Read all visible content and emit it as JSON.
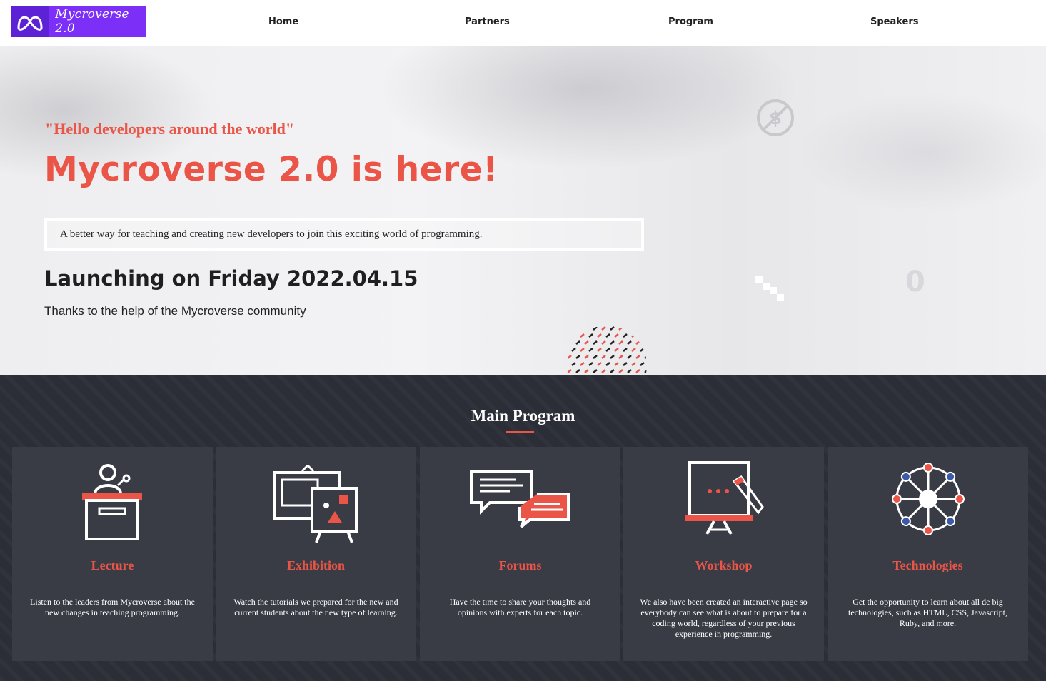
{
  "nav": {
    "logo_text": "Mycroverse 2.0",
    "links": [
      "Home",
      "Partners",
      "Program",
      "Speakers"
    ]
  },
  "hero": {
    "quote": "\"Hello developers around the world\"",
    "title": "Mycroverse 2.0 is here!",
    "description": "A better way for teaching and creating new developers to join this exciting world of programming.",
    "launch": "Launching on Friday 2022.04.15",
    "thanks": "Thanks to the help of the Mycroverse community",
    "deco_text": "0"
  },
  "program": {
    "title": "Main Program",
    "cards": [
      {
        "title": "Lecture",
        "desc": "Listen to the leaders from Mycroverse about the new changes in teaching programming.",
        "icon": "lecture-podium-icon"
      },
      {
        "title": "Exhibition",
        "desc": "Watch the tutorials we prepared for the new and current students about the new type of learning.",
        "icon": "exhibition-easel-icon"
      },
      {
        "title": "Forums",
        "desc": "Have the time to share your thoughts and opinions with experts for each topic.",
        "icon": "forum-chat-icon"
      },
      {
        "title": "Workshop",
        "desc": "We also have been created an interactive page so everybody can see what is about to prepare for a coding world, regardless of your previous experience in programming.",
        "icon": "workshop-board-icon"
      },
      {
        "title": "Technologies",
        "desc": "Get the opportunity to learn about all de big technologies, such as HTML, CSS, Javascript, Ruby, and more.",
        "icon": "technologies-network-icon"
      }
    ]
  },
  "colors": {
    "accent": "#ea5547",
    "brand": "#7b2ff7",
    "dark_bg": "#2c2e37",
    "card_bg": "#3a3c45"
  }
}
